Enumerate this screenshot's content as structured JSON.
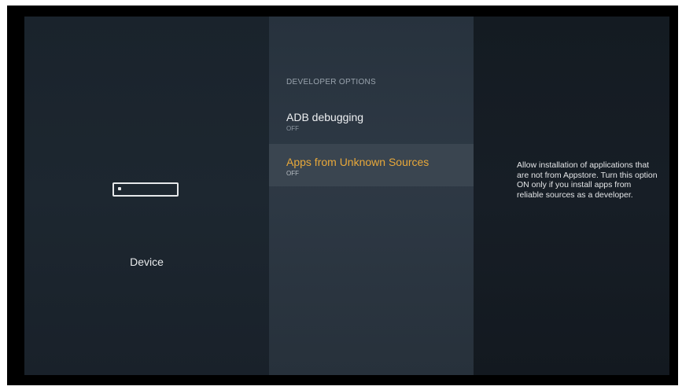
{
  "left_panel": {
    "icon": "fire-tv-device-icon",
    "label": "Device"
  },
  "developer_options": {
    "header": "DEVELOPER OPTIONS",
    "items": [
      {
        "title": "ADB debugging",
        "status": "OFF"
      },
      {
        "title": "Apps from Unknown Sources",
        "status": "OFF"
      }
    ],
    "focused_index": 1
  },
  "right_panel": {
    "description": "Allow installation of applications that are not from Appstore. Turn this option ON only if you install apps from reliable sources as a developer."
  },
  "colors": {
    "highlight_text": "#e8a83a",
    "focused_row": "#3a4550"
  }
}
